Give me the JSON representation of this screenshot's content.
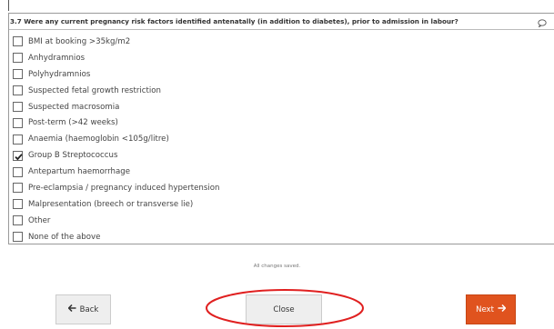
{
  "question": {
    "text": "3.7 Were any current pregnancy risk factors identified antenatally (in addition to diabetes), prior to admission in labour?",
    "options": [
      {
        "label": "BMI at booking >35kg/m2",
        "checked": false
      },
      {
        "label": "Anhydramnios",
        "checked": false
      },
      {
        "label": "Polyhydramnios",
        "checked": false
      },
      {
        "label": "Suspected fetal growth restriction",
        "checked": false
      },
      {
        "label": "Suspected macrosomia",
        "checked": false
      },
      {
        "label": "Post-term (>42 weeks)",
        "checked": false
      },
      {
        "label": "Anaemia (haemoglobin <105g/litre)",
        "checked": false
      },
      {
        "label": "Group B Streptococcus",
        "checked": true
      },
      {
        "label": "Antepartum haemorrhage",
        "checked": false
      },
      {
        "label": "Pre-eclampsia / pregnancy induced hypertension",
        "checked": false
      },
      {
        "label": "Malpresentation (breech or transverse lie)",
        "checked": false
      },
      {
        "label": "Other",
        "checked": false
      },
      {
        "label": "None of the above",
        "checked": false
      }
    ]
  },
  "status": "All changes saved.",
  "buttons": {
    "back": "Back",
    "close": "Close",
    "next": "Next"
  },
  "colors": {
    "next_button": "#e0531e",
    "annotation": "#e02020"
  },
  "icons": {
    "comment": "comment-bubble-icon",
    "back": "arrow-left-icon",
    "next": "arrow-right-icon",
    "check": "checkmark-icon"
  }
}
